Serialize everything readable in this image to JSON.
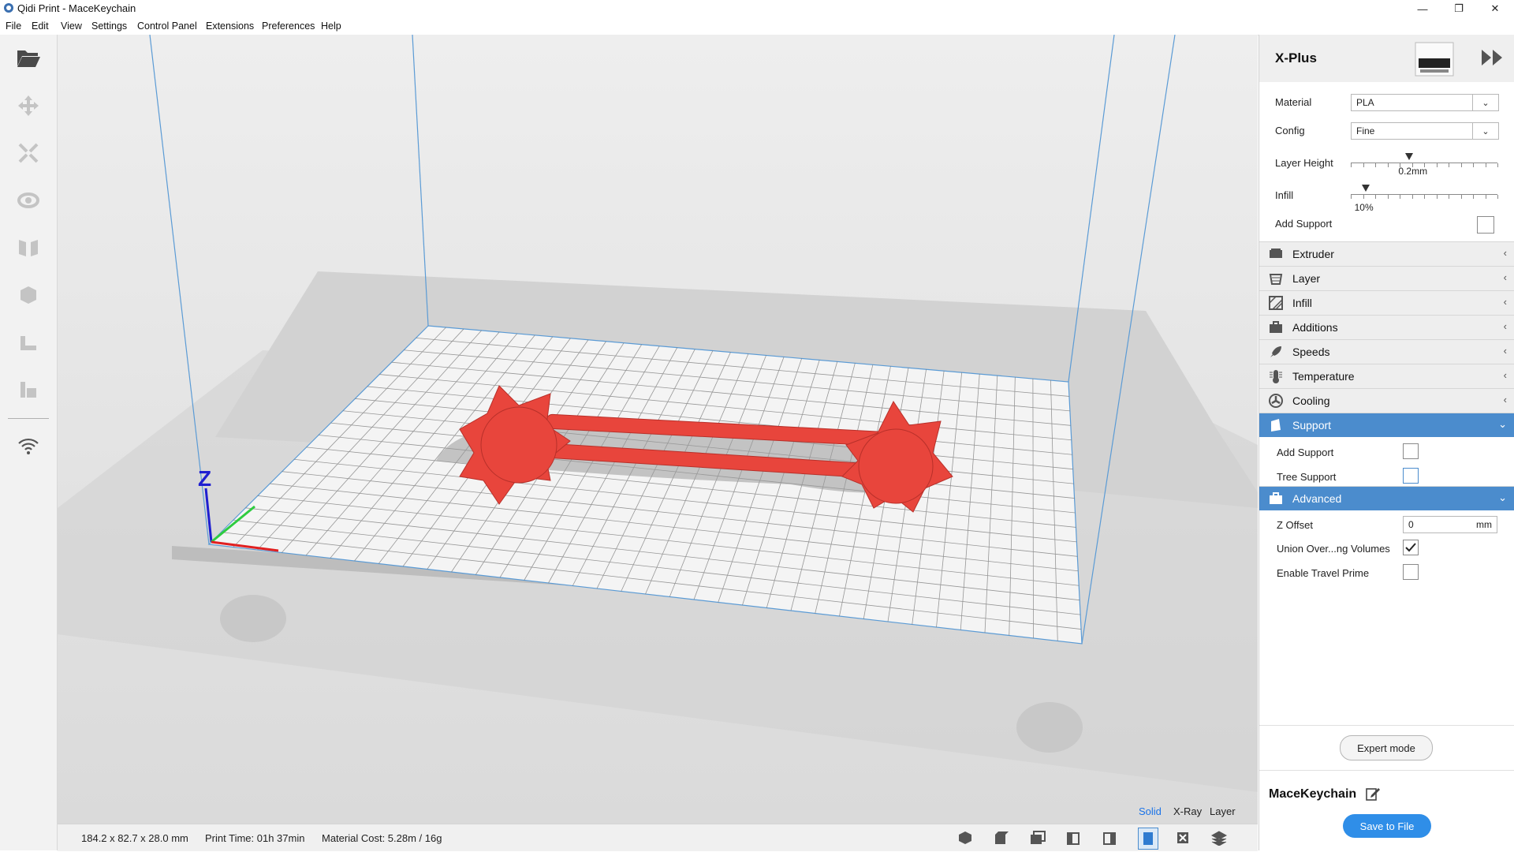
{
  "window": {
    "title": "Qidi Print - MaceKeychain",
    "minimize": "—",
    "restore": "❐",
    "close": "✕"
  },
  "menu": [
    "File",
    "Edit",
    "View",
    "Settings",
    "Control Panel",
    "Extensions",
    "Preferences",
    "Help"
  ],
  "toolbar": {
    "icons": [
      "folder-open-icon",
      "move-icon",
      "scale-icon",
      "rotate-icon",
      "mirror-icon",
      "per-model-settings-icon",
      "support-blocker-icon",
      "lay-flat-icon",
      "wifi-icon"
    ]
  },
  "viewport": {
    "axis_z": "Z",
    "view_modes": [
      "Solid",
      "X-Ray",
      "Layer"
    ],
    "active_view_mode": "Solid",
    "accent_color": "#1a73e8",
    "model_color": "#e8453c"
  },
  "statusbar": {
    "dimensions": "184.2 x 82.7 x 28.0 mm",
    "print_time": "Print Time: 01h 37min",
    "material_cost": "Material Cost: 5.28m / 16g",
    "camera_icons": [
      "view-3d-icon",
      "view-front-icon",
      "view-top-icon",
      "view-left-icon",
      "view-right-icon",
      "view-solid-icon",
      "view-xray-icon",
      "view-layer-icon"
    ]
  },
  "panel": {
    "printer_name": "X-Plus",
    "material_label": "Material",
    "material_value": "PLA",
    "config_label": "Config",
    "config_value": "Fine",
    "layer_height_label": "Layer Height",
    "layer_height_value": "0.2mm",
    "layer_height_fraction": 0.4,
    "infill_label": "Infill",
    "infill_value": "10%",
    "infill_fraction": 0.1,
    "add_support_label": "Add Support",
    "sections": [
      {
        "name": "Extruder",
        "icon": "extruder-icon"
      },
      {
        "name": "Layer",
        "icon": "layer-icon"
      },
      {
        "name": "Infill",
        "icon": "infill-icon"
      },
      {
        "name": "Additions",
        "icon": "additions-icon"
      },
      {
        "name": "Speeds",
        "icon": "speeds-icon"
      },
      {
        "name": "Temperature",
        "icon": "temperature-icon"
      },
      {
        "name": "Cooling",
        "icon": "cooling-icon"
      },
      {
        "name": "Support",
        "icon": "support-icon"
      },
      {
        "name": "Advanced",
        "icon": "advanced-icon"
      }
    ],
    "support": {
      "add_support": "Add Support",
      "add_support_checked": false,
      "tree_support": "Tree Support",
      "tree_support_checked": false
    },
    "advanced": {
      "z_offset": "Z Offset",
      "z_offset_value": "0",
      "z_offset_unit": "mm",
      "union_volumes": "Union Over...ng Volumes",
      "union_volumes_checked": true,
      "travel_prime": "Enable Travel Prime",
      "travel_prime_checked": false
    },
    "expert_mode": "Expert mode",
    "job_name": "MaceKeychain",
    "save_button": "Save to File"
  }
}
